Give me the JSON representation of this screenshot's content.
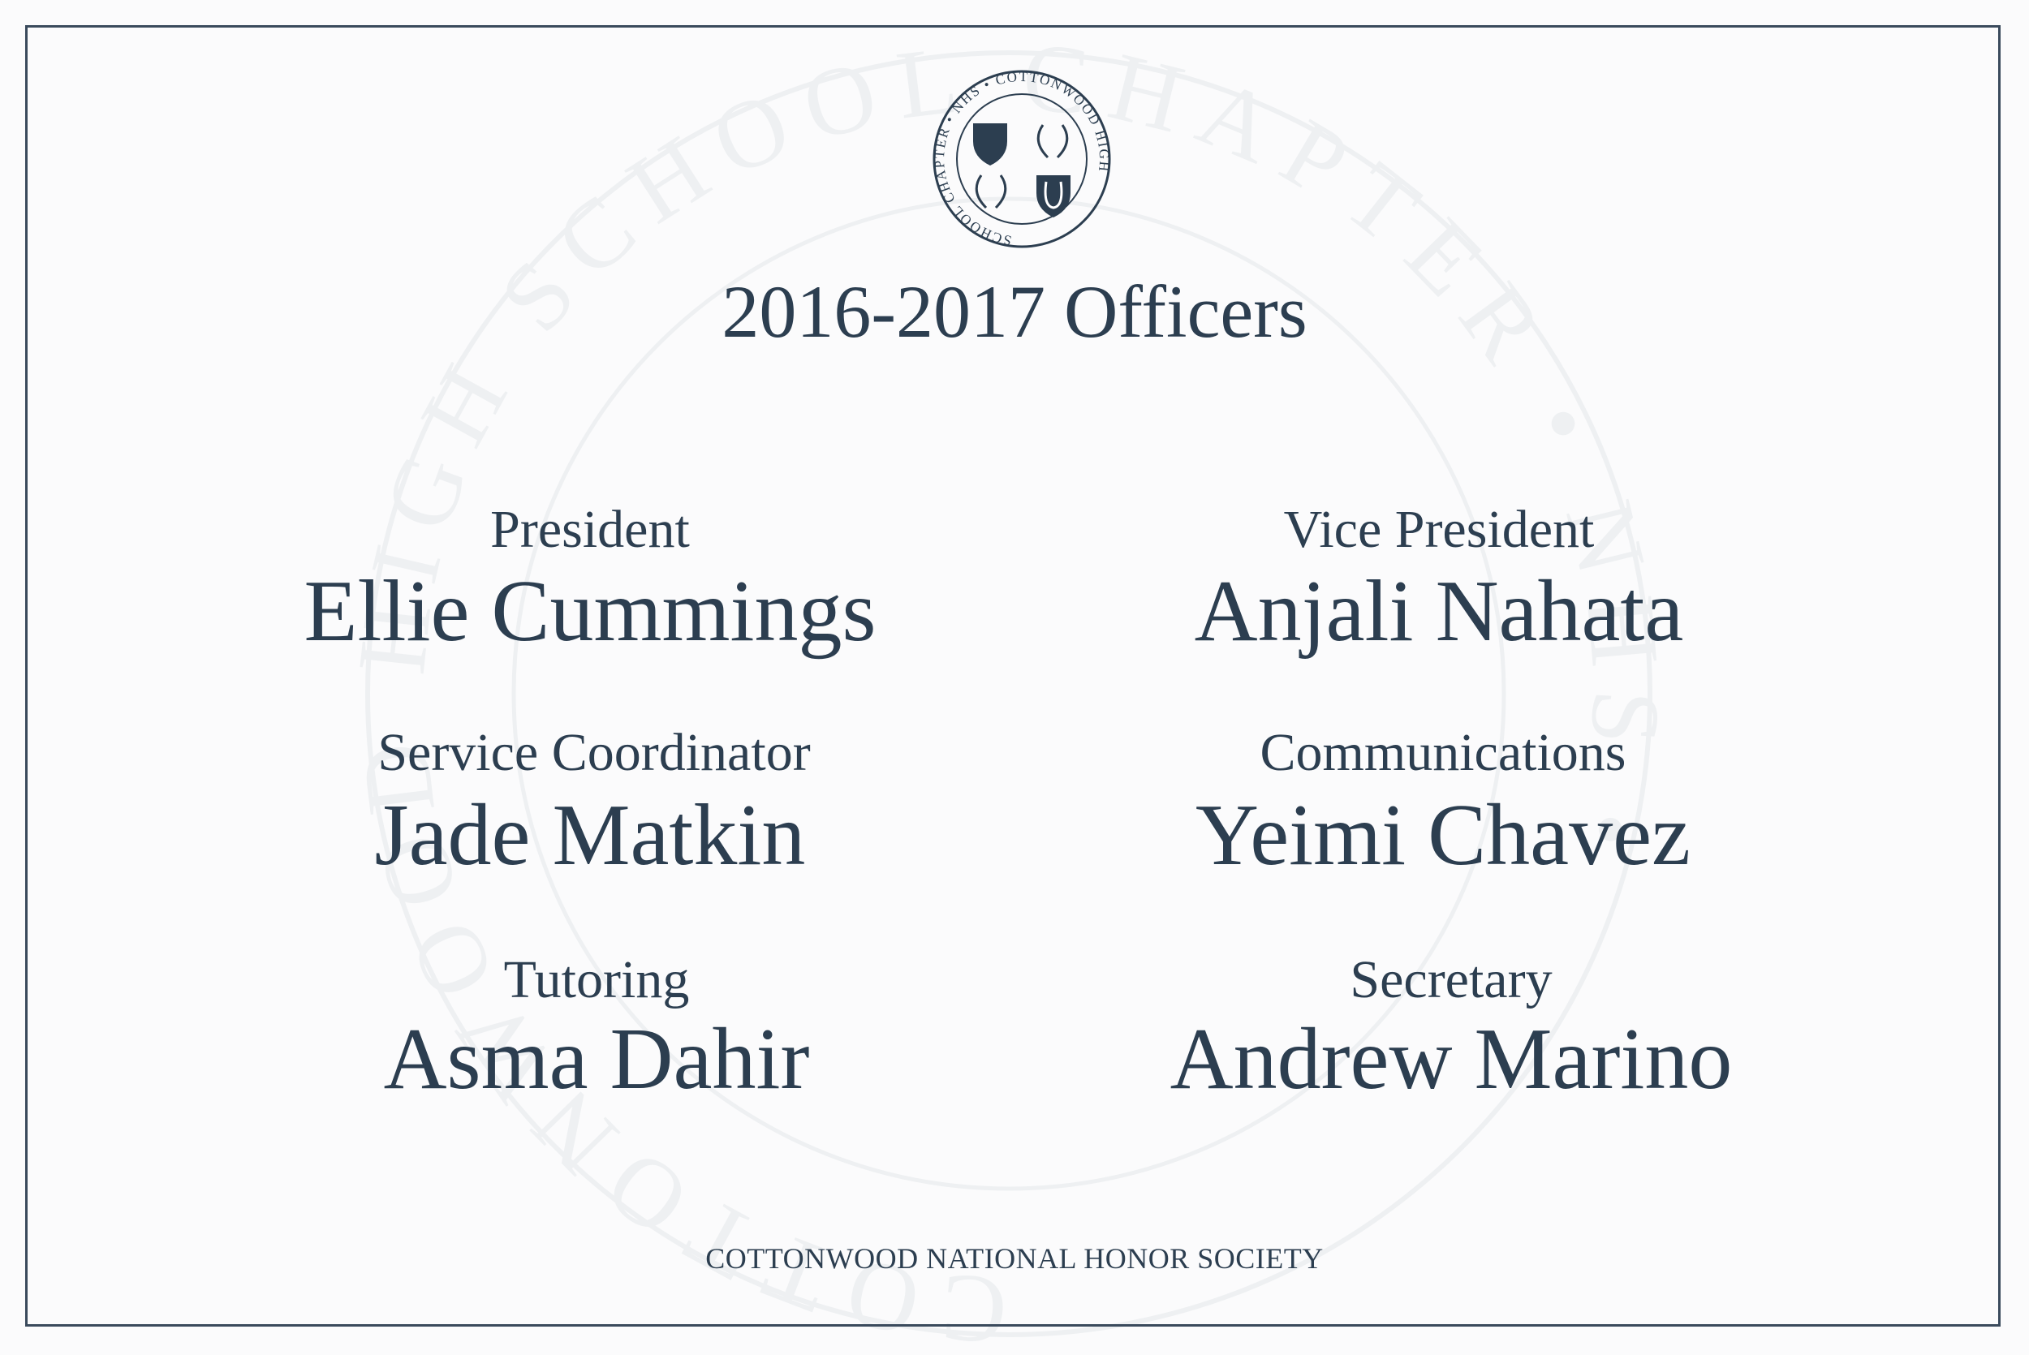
{
  "seal": {
    "text": "SCHOOL CHAPTER • NHS • COTTONWOOD HIGH",
    "watermark_text": "COTTONWOOD HIGH SCHOOL CHAPTER • NHS •"
  },
  "title": "2016-2017 Officers",
  "officers": [
    {
      "role": "President",
      "name": "Ellie Cummings"
    },
    {
      "role": "Vice President",
      "name": "Anjali Nahata"
    },
    {
      "role": "Service Coordinator",
      "name": "Jade Matkin"
    },
    {
      "role": "Communications",
      "name": "Yeimi Chavez"
    },
    {
      "role": "Tutoring",
      "name": "Asma Dahir"
    },
    {
      "role": "Secretary",
      "name": "Andrew Marino"
    }
  ],
  "footer": "COTTONWOOD NATIONAL HONOR SOCIETY",
  "colors": {
    "ink": "#2c3e50",
    "background": "#fbfbfc"
  }
}
